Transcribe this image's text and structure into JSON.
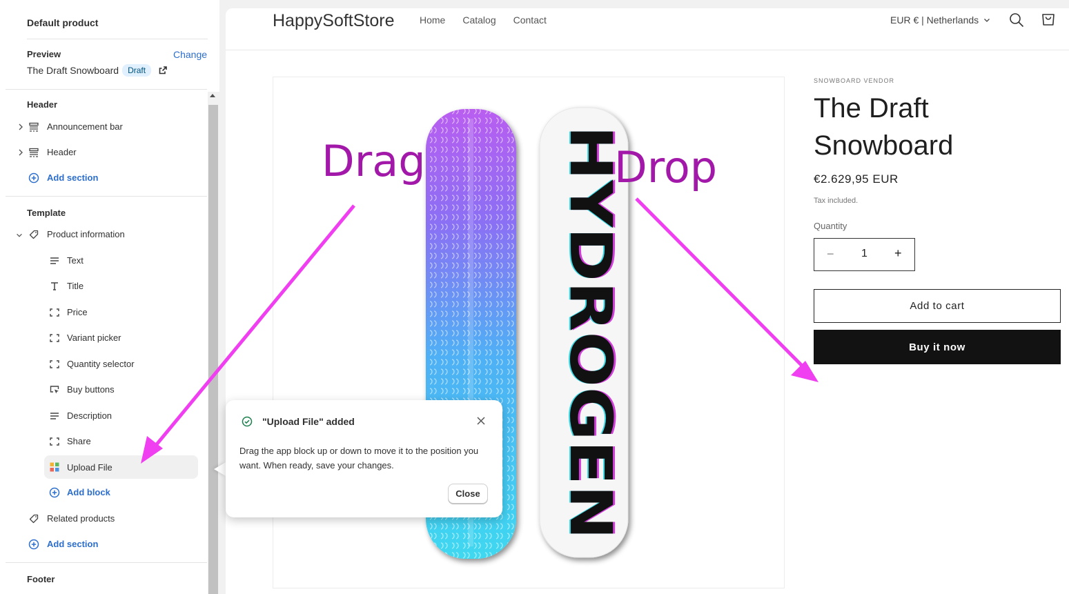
{
  "sidebar": {
    "title": "Default product",
    "preview_label": "Preview",
    "change_link": "Change",
    "preview_product": "The Draft Snowboard",
    "preview_badge": "Draft",
    "sections": {
      "header": {
        "title": "Header",
        "items": [
          "Announcement bar",
          "Header"
        ],
        "add": "Add section"
      },
      "template": {
        "title": "Template",
        "product_info": "Product information",
        "blocks": [
          "Text",
          "Title",
          "Price",
          "Variant picker",
          "Quantity selector",
          "Buy buttons",
          "Description",
          "Share",
          "Upload File"
        ],
        "add_block": "Add block",
        "related": "Related products",
        "add": "Add section"
      },
      "footer": {
        "title": "Footer"
      }
    },
    "accent_color": "#2c6ecb"
  },
  "store": {
    "name": "HappySoftStore",
    "nav": [
      "Home",
      "Catalog",
      "Contact"
    ],
    "locale": "EUR € | Netherlands",
    "icons": [
      "search-icon",
      "cart-icon"
    ]
  },
  "product": {
    "vendor": "SNOWBOARD VENDOR",
    "title": "The Draft Snowboard",
    "price": "€2.629,95 EUR",
    "tax": "Tax included.",
    "quantity_label": "Quantity",
    "quantity": "1",
    "minus": "−",
    "plus": "+",
    "add_to_cart": "Add to cart",
    "buy_now": "Buy it now",
    "board_graphic_text": "HYDROGEN"
  },
  "popover": {
    "title": "\"Upload File\" added",
    "body": "Drag the app block up or down to move it to the position you want. When ready, save your changes.",
    "close": "Close"
  },
  "annotations": {
    "drag": "Drag",
    "drop": "Drop",
    "arrow_color": "#f03ff0",
    "text_color": "#a218a8"
  }
}
